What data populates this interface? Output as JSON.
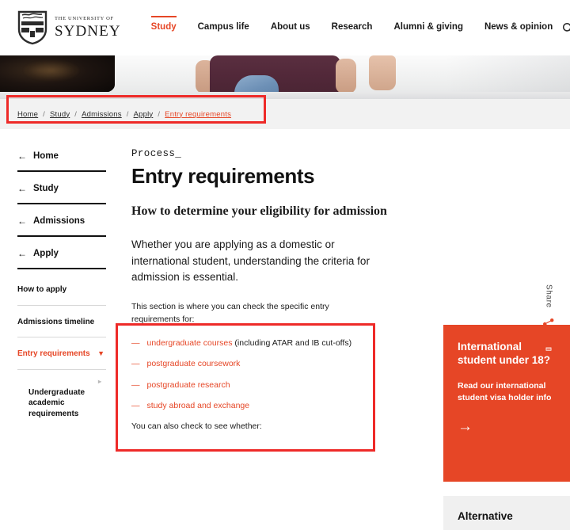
{
  "colors": {
    "brand_orange": "#e64626",
    "annotation_red": "#ee2a28",
    "band_grey": "#f2f2f2",
    "card_grey": "#f0f0f0"
  },
  "header": {
    "brand": {
      "line1": "THE UNIVERSITY OF",
      "line2": "SYDNEY",
      "crest_icon": "university-crest-icon"
    },
    "nav": [
      {
        "label": "Study",
        "active": true
      },
      {
        "label": "Campus life",
        "active": false
      },
      {
        "label": "About us",
        "active": false
      },
      {
        "label": "Research",
        "active": false
      },
      {
        "label": "Alumni & giving",
        "active": false
      },
      {
        "label": "News & opinion",
        "active": false
      }
    ],
    "search_icon": "search-icon"
  },
  "breadcrumb": {
    "items": [
      {
        "label": "Home",
        "current": false
      },
      {
        "label": "Study",
        "current": false
      },
      {
        "label": "Admissions",
        "current": false
      },
      {
        "label": "Apply",
        "current": false
      },
      {
        "label": "Entry requirements",
        "current": true
      }
    ],
    "separator": "/"
  },
  "sidebar": {
    "back_links": [
      {
        "label": "Home",
        "arrow": "←"
      },
      {
        "label": "Study",
        "arrow": "←"
      },
      {
        "label": "Admissions",
        "arrow": "←"
      },
      {
        "label": "Apply",
        "arrow": "←"
      }
    ],
    "links": [
      {
        "label": "How to apply",
        "current": false
      },
      {
        "label": "Admissions timeline",
        "current": false
      },
      {
        "label": "Entry requirements",
        "current": true,
        "chevron": "▼"
      }
    ],
    "sub_links": [
      {
        "label": "Undergraduate academic requirements",
        "caret": "▸"
      }
    ]
  },
  "main": {
    "eyebrow": "Process_",
    "title": "Entry requirements",
    "subhead": "How to determine your eligibility for admission",
    "intro": "Whether you are applying as a domestic or international student, understanding the criteria for admission is essential.",
    "section_lead": "This section is where you can check the specific entry requirements for:",
    "bullets": [
      {
        "dash": "—",
        "link": "undergraduate courses",
        "trailing": " (including ATAR and IB cut-offs)"
      },
      {
        "dash": "—",
        "link": "postgraduate coursework",
        "trailing": ""
      },
      {
        "dash": "—",
        "link": "postgraduate research",
        "trailing": ""
      },
      {
        "dash": "—",
        "link": "study abroad and exchange",
        "trailing": ""
      }
    ],
    "after_list": "You can also check to see whether:"
  },
  "promo": {
    "title": "International student under 18?",
    "text": "Read our international student visa holder info",
    "arrow": "→"
  },
  "alternative_card": {
    "title": "Alternative"
  },
  "share": {
    "label": "Share",
    "share_icon": "share-network-icon",
    "print_icon": "printer-icon"
  }
}
